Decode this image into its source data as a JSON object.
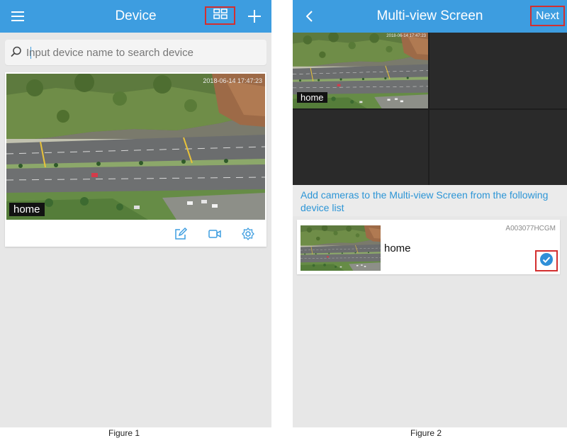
{
  "figure1": {
    "header": {
      "title": "Device",
      "menu_icon": "menu-icon",
      "grid_icon": "grid-view-icon",
      "add_icon": "plus-icon"
    },
    "search": {
      "placeholder": "Input device name to search device",
      "icon": "search-icon"
    },
    "device_card": {
      "timestamp": "2018-06-14  17:47:23",
      "name": "home",
      "actions": [
        "edit-icon",
        "video-icon",
        "settings-icon"
      ]
    },
    "caption": "Figure 1"
  },
  "figure2": {
    "header": {
      "title": "Multi-view Screen",
      "back_icon": "back-icon",
      "next_label": "Next"
    },
    "preview": {
      "tile_label": "home",
      "tile_timestamp": "2018-06-14 17:47:23"
    },
    "info": "Add cameras to the Multi-view Screen from the following device list",
    "device_list": [
      {
        "name": "home",
        "id": "A003077HCGM",
        "checked": true
      }
    ],
    "caption": "Figure 2"
  },
  "colors": {
    "accent": "#3d9de0",
    "highlight_box": "#d32f2f",
    "info_text": "#2c95d6",
    "background": "#e7e7e7"
  }
}
